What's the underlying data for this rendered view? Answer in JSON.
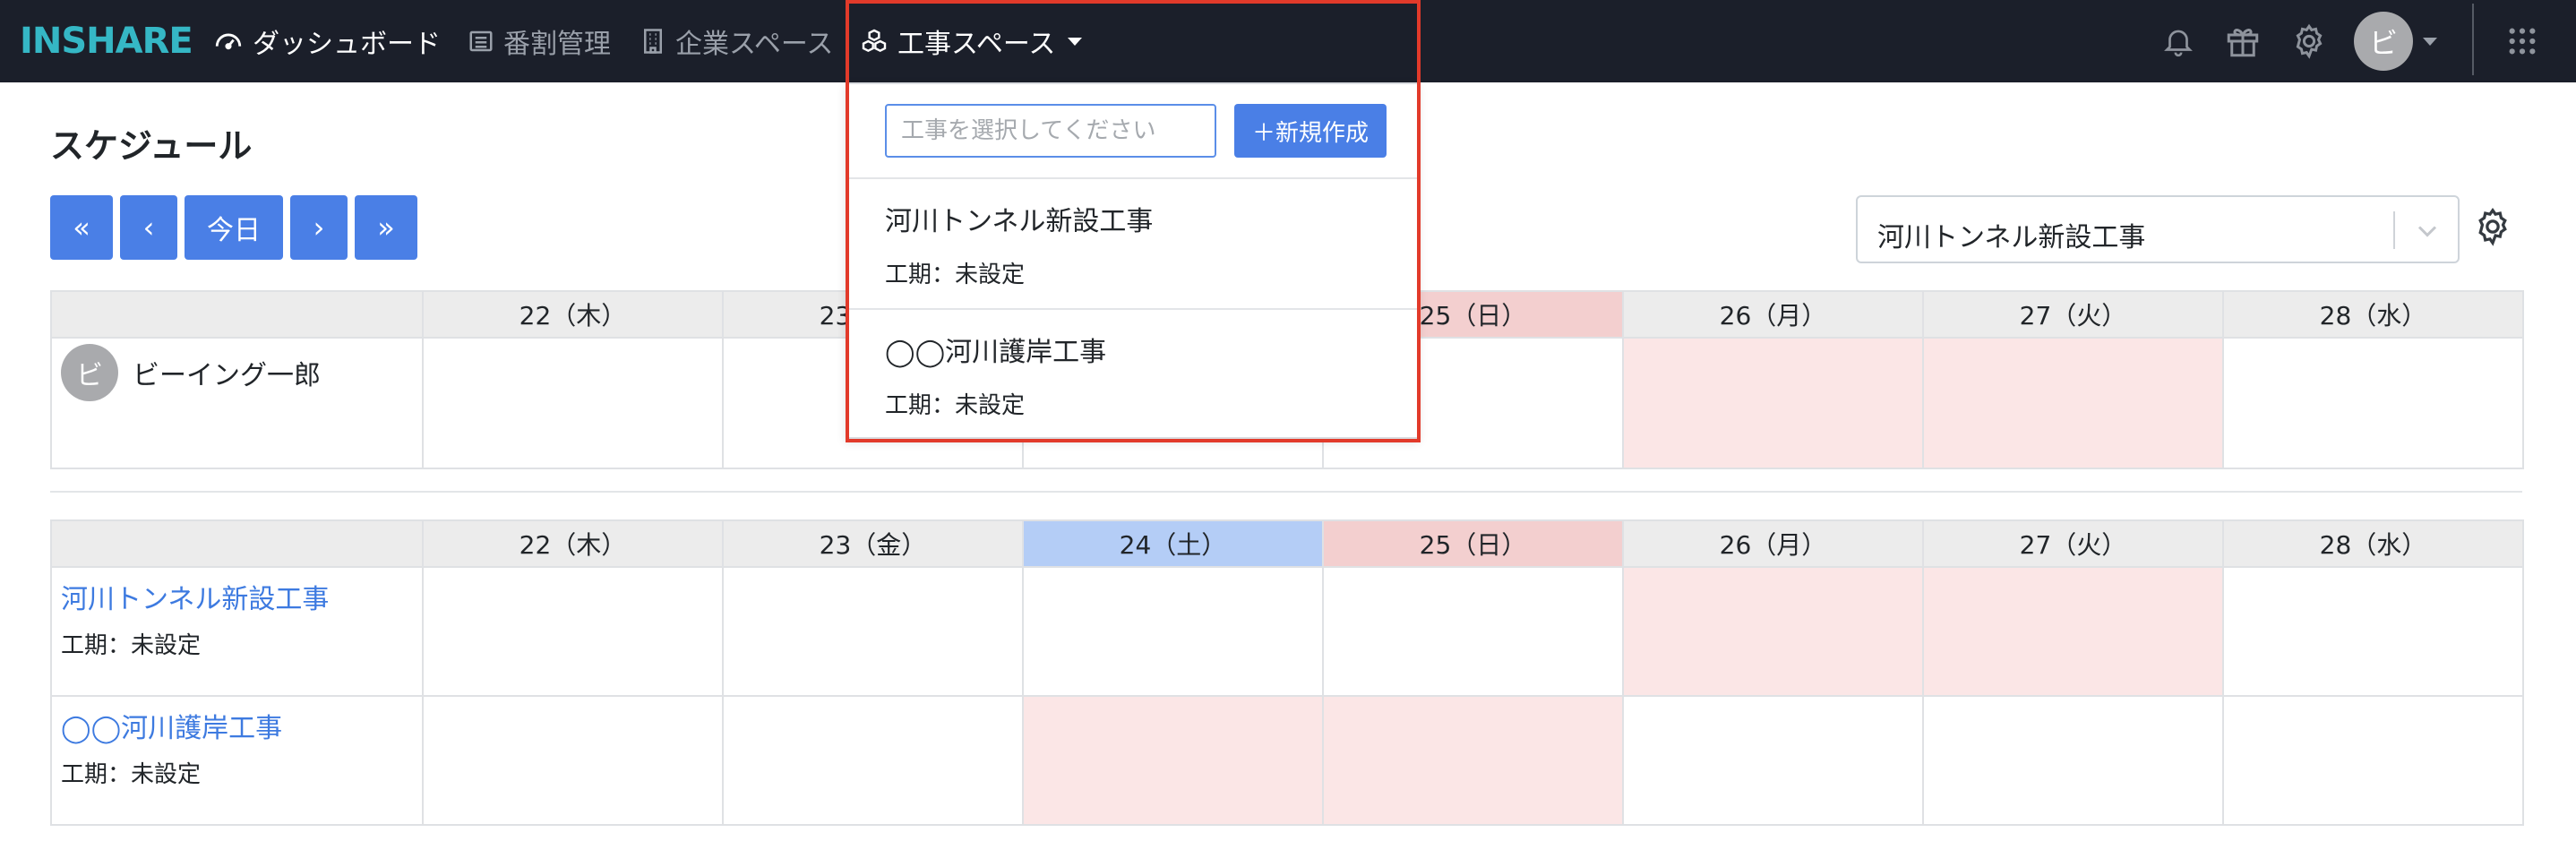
{
  "nav": {
    "brand": "INSHARE",
    "dashboard": "ダッシュボード",
    "numbering": "番割管理",
    "company_space": "企業スペース",
    "construction_space": "工事スペース",
    "avatar_initial": "ビ"
  },
  "page": {
    "title": "スケジュール",
    "buttons": {
      "first": "«",
      "prev": "‹",
      "today": "今日",
      "next": "›",
      "last": "»"
    },
    "project_select": {
      "value": "河川トンネル新設工事"
    }
  },
  "days": [
    "22（木）",
    "23（金）",
    "24（土）",
    "25（日）",
    "26（月）",
    "27（火）",
    "28（水）"
  ],
  "member_table": {
    "members": [
      {
        "initial": "ビ",
        "name": "ビーイング一郎"
      }
    ]
  },
  "project_table": {
    "projects": [
      {
        "name": "河川トンネル新設工事",
        "period": "工期：未設定"
      },
      {
        "name": "◯◯河川護岸工事",
        "period": "工期：未設定"
      }
    ]
  },
  "dropdown": {
    "search_placeholder": "工事を選択してください",
    "new_button": "＋新規作成",
    "items": [
      {
        "name": "河川トンネル新設工事",
        "period": "工期：未設定"
      },
      {
        "name": "◯◯河川護岸工事",
        "period": "工期：未設定"
      }
    ]
  },
  "colors": {
    "navbar_bg": "#1b1f2a",
    "brand": "#35b7c5",
    "primary": "#4a7fe6",
    "saturday": "#b4cdf6",
    "sunday": "#f3cfcf",
    "holiday_cell": "#fbe6e6",
    "highlight": "#e23a2a"
  }
}
